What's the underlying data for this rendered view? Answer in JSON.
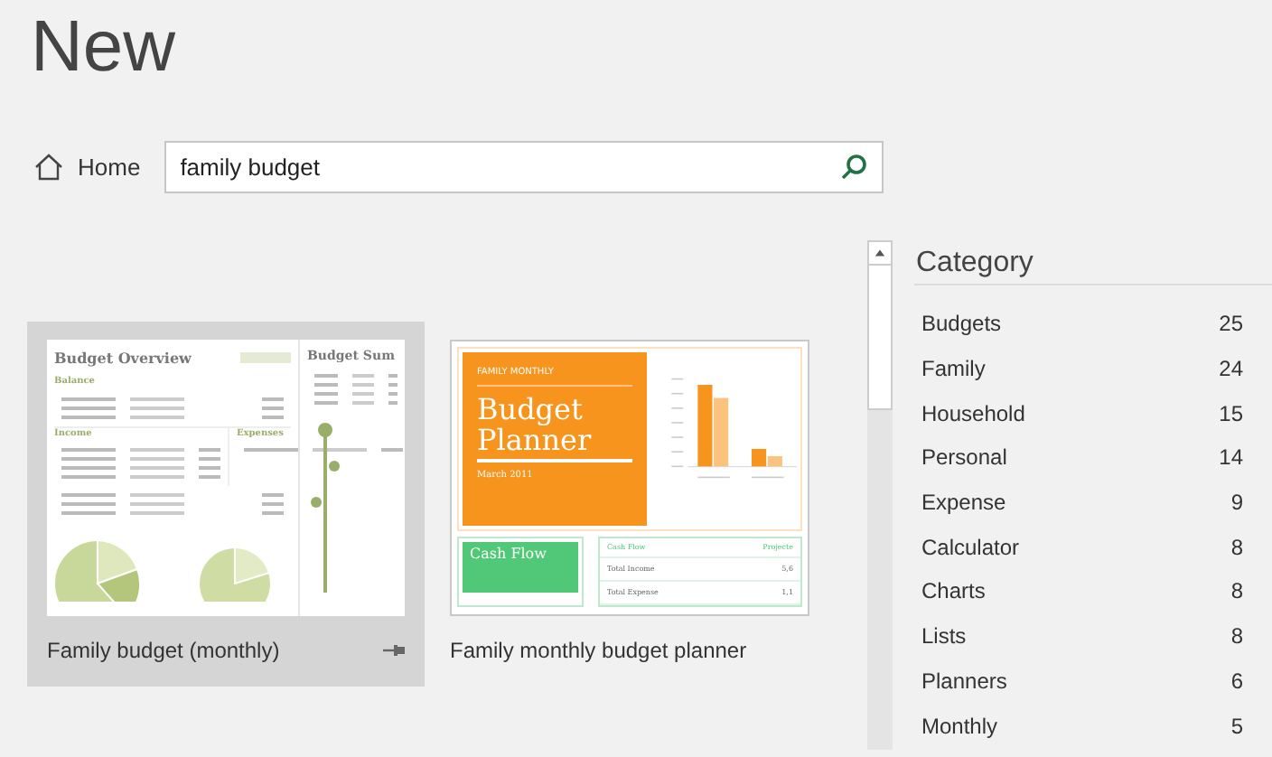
{
  "title": "New",
  "home": {
    "label": "Home"
  },
  "search": {
    "value": "family budget"
  },
  "templates": [
    {
      "kind": "overview",
      "name": "Family budget (monthly)",
      "selected": true,
      "pinned": true,
      "preview": {
        "heading": "Budget Overview",
        "side_heading": "Budget Sum",
        "sections": [
          "Balance",
          "Income",
          "Expenses"
        ]
      }
    },
    {
      "kind": "planner",
      "name": "Family monthly budget planner",
      "selected": false,
      "pinned": false,
      "preview": {
        "eyebrow": "FAMILY MONTHLY",
        "heading": "Budget Planner",
        "date": "March 2011",
        "tile": "Cash Flow",
        "table_heading": "Cash Flow",
        "table_column": "Projecte",
        "rows": [
          "Total Income",
          "Total Expense"
        ],
        "row_values": [
          "5,6",
          "1,1"
        ]
      }
    }
  ],
  "category": {
    "title": "Category",
    "items": [
      {
        "label": "Budgets",
        "count": "25"
      },
      {
        "label": "Family",
        "count": "24"
      },
      {
        "label": "Household",
        "count": "15"
      },
      {
        "label": "Personal",
        "count": "14"
      },
      {
        "label": "Expense",
        "count": "9"
      },
      {
        "label": "Calculator",
        "count": "8"
      },
      {
        "label": "Charts",
        "count": "8"
      },
      {
        "label": "Lists",
        "count": "8"
      },
      {
        "label": "Planners",
        "count": "6"
      },
      {
        "label": "Monthly",
        "count": "5"
      }
    ]
  }
}
